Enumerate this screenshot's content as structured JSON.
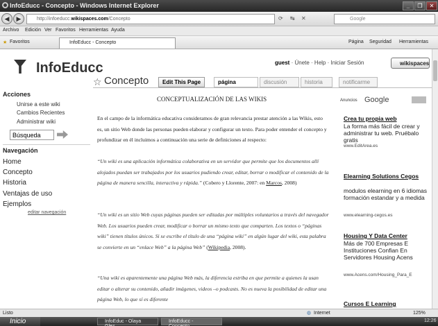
{
  "window": {
    "title": "InfoEducc - Concepto - Windows Internet Explorer"
  },
  "address": {
    "prefix": "http://infoeducc.",
    "domain": "wikispaces.com",
    "suffix": "/Concepto",
    "search_placeholder": "Google"
  },
  "menu": [
    "Archivo",
    "Edición",
    "Ver",
    "Favoritos",
    "Herramientas",
    "Ayuda"
  ],
  "favbar": {
    "favoritos": "Favoritos",
    "tab_title": "InfoEducc - Concepto",
    "tools": [
      "Página",
      "Seguridad",
      "Herramientas"
    ]
  },
  "site": {
    "name": "InfoEducc",
    "guest": "guest",
    "links": "· Únete · Help · Iniciar Sesión",
    "wikispaces": "wikispaces"
  },
  "page": {
    "name": "Concepto",
    "edit": "Edit This Page",
    "tabs": {
      "pagina": "página",
      "discusion": "discusión",
      "historia": "historia",
      "notificarme": "notificarme"
    }
  },
  "sidebar": {
    "acciones_title": "Acciones",
    "acciones": [
      "Unirse a este wiki",
      "Cambios Recientes",
      "Administrar wiki"
    ],
    "search_value": "Búsqueda",
    "nav_title": "Navegación",
    "nav": [
      "Home",
      "Concepto",
      "Historia",
      "Ventajas de uso",
      "Ejemplos"
    ],
    "edit_nav": "editar navegación"
  },
  "content": {
    "title": "CONCEPTUALIZACIÓN DE LAS WIKIS",
    "p1": "En el campo de la informática educativa consideramos de gran relevancia prestar atención a las Wikis, esto es, un sitio Web donde las personas pueden elaborar y configurar un texto. Para poder entender el concepto y profundizar en él incluimos a continuación una serie de definiciones al respecto:",
    "q1": "“Un wiki es una aplicación informática colaborativa en un servidor que permite que los documentos allí alojados puedan ser trabajados por los usuarios pudiendo crear, editar, borrar o modificar el contenido de la página de manera sencilla, interactiva y rápida.”",
    "q1_cite": "(Cobero y Llorente, 2007: en",
    "q1_link": "Marcos",
    "q1_end": ", 2008)",
    "q2": "“Un wiki es un sitio Web cuyas páginas pueden ser editadas por múltiples voluntarios a través del navegador Web. Los usuarios pueden crear, modificar o borrar un mismo texto que comparten. Los textos o “páginas wiki” tienen títulos únicos. Si se escribe el título de una “página wiki” en algún lugar del wiki, esta palabra se convierte en un “enlace Web” a la página Web”",
    "q2_link": "Wikipedia",
    "q2_end": ", 2008).",
    "q3": "“Una wiki es aparentemente una página Web más, la diferencia estriba en que permite a quienes la usan editar o alterar su contenido, añadir imágenes, videos –o podcasts. No es nueva la posibilidad de editar una página Web, lo que sí es diferente"
  },
  "ads": {
    "label": "Anuncios",
    "google": "Google",
    "items": [
      {
        "title": "Crea tu propia web",
        "body": "La forma más fácil de crear y administrar tu web. Pruébalo gratis",
        "url": "www.EditArea.es"
      },
      {
        "title": "Elearning Solutions Cegos",
        "body": "modulos elearning en 6 idiomas formación estandar y a medida",
        "url": "www.elearning-cegos.es"
      },
      {
        "title": "Housing Y Data Center",
        "body": "Más de 700 Empresas E Instituciones Confian En Servidores Housing Acens",
        "url": "www.Acens.com/Housing_Para_E"
      },
      {
        "title": "Cursos E Learning",
        "body": "",
        "url": ""
      }
    ]
  },
  "status": {
    "left": "Listo",
    "zone": "Internet",
    "zoom": "125%"
  },
  "taskbar": {
    "start": "Inicio",
    "items": [
      "InfoEduc - Olaya Glez...",
      "InfoEducc - Concepto..."
    ],
    "clock": "12:26"
  }
}
